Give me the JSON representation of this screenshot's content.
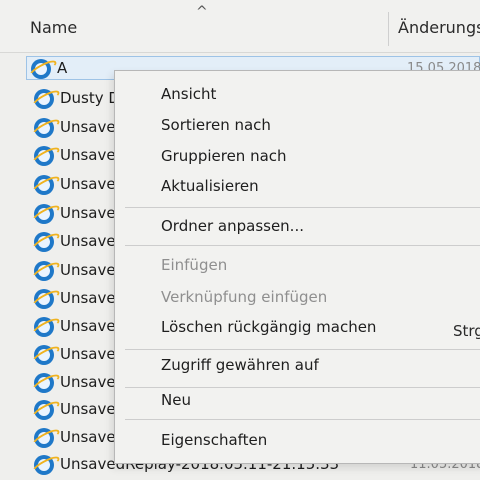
{
  "header": {
    "name_label": "Name",
    "date_label": "Änderungs",
    "sort_glyph": "^"
  },
  "files": [
    {
      "name": "A",
      "date": "15.05.2018"
    },
    {
      "name": "Dusty D",
      "date": ""
    },
    {
      "name": "Unsave",
      "date": ""
    },
    {
      "name": "Unsave",
      "date": ""
    },
    {
      "name": "Unsave",
      "date": ""
    },
    {
      "name": "Unsave",
      "date": ""
    },
    {
      "name": "Unsave",
      "date": ""
    },
    {
      "name": "Unsave",
      "date": ""
    },
    {
      "name": "Unsave",
      "date": ""
    },
    {
      "name": "Unsave",
      "date": ""
    },
    {
      "name": "Unsave",
      "date": ""
    },
    {
      "name": "Unsave",
      "date": ""
    },
    {
      "name": "Unsave",
      "date": ""
    },
    {
      "name": "Unsave",
      "date": ""
    },
    {
      "name": "UnsavedReplay-2018.05.11-21.15.33",
      "date": "11.05.2018"
    }
  ],
  "icons": {
    "file_icon": "internet-explorer-icon"
  },
  "context_menu": {
    "view": "Ansicht",
    "sort_by": "Sortieren nach",
    "group_by": "Gruppieren nach",
    "refresh": "Aktualisieren",
    "customize_folder": "Ordner anpassen...",
    "paste": "Einfügen",
    "paste_shortcut": "Verknüpfung einfügen",
    "undo_delete": "Löschen rückgängig machen",
    "undo_delete_shortcut": "Strg",
    "give_access": "Zugriff gewähren auf",
    "new": "Neu",
    "properties": "Eigenschaften"
  },
  "colors": {
    "selection_border": "#9ec3e6",
    "selection_fill": "#e3eef8",
    "disabled_text": "#8f8f8f"
  }
}
